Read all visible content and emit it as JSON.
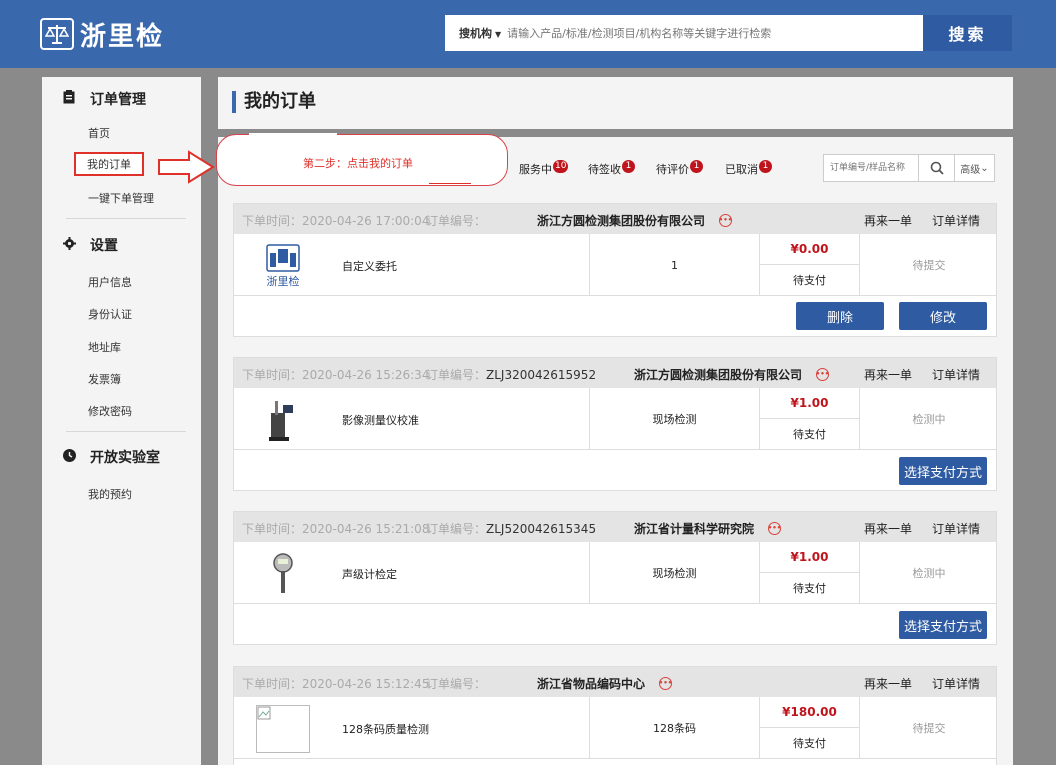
{
  "header": {
    "logo_text": "浙里检",
    "search_scope": "搜机构",
    "search_placeholder": "请输入产品/标准/检测项目/机构名称等关键字进行检索",
    "search_button": "搜索"
  },
  "sidebar": {
    "sections": [
      {
        "title": "订单管理",
        "icon": "clipboard-icon",
        "items": [
          "首页",
          "我的订单",
          "一键下单管理"
        ]
      },
      {
        "title": "设置",
        "icon": "gear-icon",
        "items": [
          "用户信息",
          "身份认证",
          "地址库",
          "发票簿",
          "修改密码"
        ]
      },
      {
        "title": "开放实验室",
        "icon": "clock-icon",
        "items": [
          "我的预约"
        ]
      }
    ]
  },
  "page_title": "我的订单",
  "callout": {
    "text": "第二步：点击我的订单"
  },
  "tabs": [
    {
      "label": "服务中",
      "badge": "10"
    },
    {
      "label": "待签收",
      "badge": "1"
    },
    {
      "label": "待评价",
      "badge": "1"
    },
    {
      "label": "已取消",
      "badge": "1"
    }
  ],
  "order_search": {
    "placeholder": "订单编号/样品名称",
    "advanced": "高级"
  },
  "orders": [
    {
      "time_label": "下单时间：2020-04-26 17:00:04",
      "no_label": "订单编号：",
      "no_value": "",
      "company": "浙江方圆检测集团股份有限公司",
      "again": "再来一单",
      "detail": "订单详情",
      "product": "自定义委托",
      "qty": "1",
      "price": "¥0.00",
      "pay_status": "待支付",
      "status": "待提交",
      "buttons": [
        "删除",
        "修改"
      ],
      "img": "logo",
      "img_label": "浙里检"
    },
    {
      "time_label": "下单时间：2020-04-26 15:26:34",
      "no_label": "订单编号：",
      "no_value": "ZLJ320042615952",
      "company": "浙江方圆检测集团股份有限公司",
      "again": "再来一单",
      "detail": "订单详情",
      "product": "影像测量仪校准",
      "qty": "现场检测",
      "price": "¥1.00",
      "pay_status": "待支付",
      "status": "检测中",
      "buttons": [
        "选择支付方式"
      ],
      "img": "machine"
    },
    {
      "time_label": "下单时间：2020-04-26 15:21:08",
      "no_label": "订单编号：",
      "no_value": "ZLJ520042615345",
      "company": "浙江省计量科学研究院",
      "again": "再来一单",
      "detail": "订单详情",
      "product": "声级计检定",
      "qty": "现场检测",
      "price": "¥1.00",
      "pay_status": "待支付",
      "status": "检测中",
      "buttons": [
        "选择支付方式"
      ],
      "img": "meter"
    },
    {
      "time_label": "下单时间：2020-04-26 15:12:45",
      "no_label": "订单编号：",
      "no_value": "",
      "company": "浙江省物品编码中心",
      "again": "再来一单",
      "detail": "订单详情",
      "product": "128条码质量检测",
      "qty": "128条码",
      "price": "¥180.00",
      "pay_status": "待支付",
      "status": "待提交",
      "buttons": [],
      "img": "broken"
    }
  ]
}
